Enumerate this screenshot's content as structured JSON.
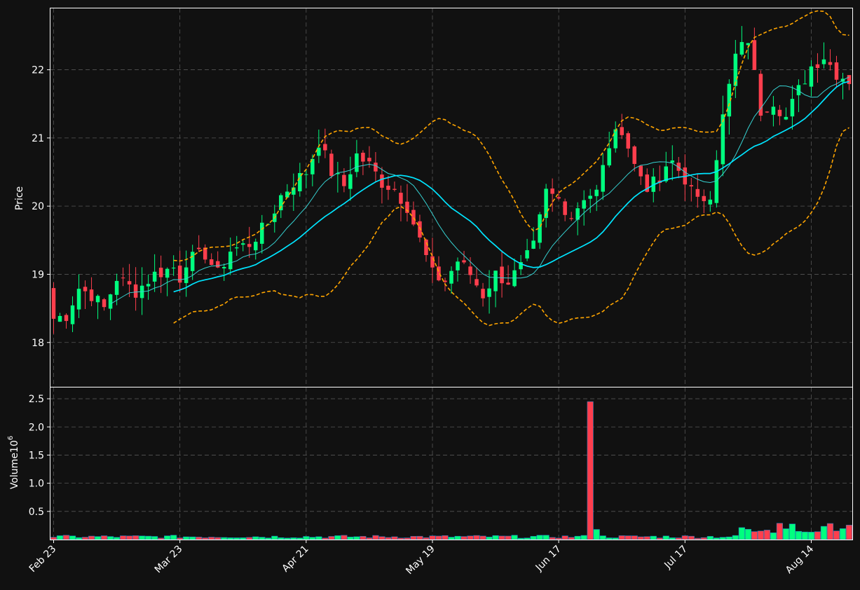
{
  "chart_data": {
    "type": "candlestick",
    "colors": {
      "background": "#111111",
      "up": "#00ff7f",
      "down": "#ff3e4d",
      "bollinger": "#ffa500",
      "ma_fast": "#36d1d1",
      "ma_slow": "#00e5ff",
      "grid": "#555555",
      "axis": "#ffffff"
    },
    "price_panel": {
      "ylabel": "Price",
      "ylim": [
        17.35,
        22.9
      ],
      "yticks": [
        18,
        19,
        20,
        21,
        22
      ]
    },
    "volume_panel": {
      "ylabel": "Volume",
      "ylabel_exp": "10",
      "ylabel_sup": "6",
      "ylim": [
        0,
        2.7
      ],
      "yticks": [
        "0.5",
        "1.0",
        "1.5",
        "2.0",
        "2.5"
      ],
      "ytick_values": [
        0.5,
        1.0,
        1.5,
        2.0,
        2.5
      ]
    },
    "xlim": [
      -0.5,
      126.5
    ],
    "xticks": [
      {
        "index": 0,
        "label": "Feb 23"
      },
      {
        "index": 20,
        "label": "Mar 23"
      },
      {
        "index": 40,
        "label": "Apr 21"
      },
      {
        "index": 60,
        "label": "May 19"
      },
      {
        "index": 80,
        "label": "Jun 17"
      },
      {
        "index": 100,
        "label": "Jul 17"
      },
      {
        "index": 120,
        "label": "Aug 14"
      }
    ],
    "close_keypoints": [
      [
        0,
        18.35
      ],
      [
        2,
        18.4
      ],
      [
        4,
        18.8
      ],
      [
        6,
        18.7
      ],
      [
        8,
        18.5
      ],
      [
        10,
        18.95
      ],
      [
        13,
        18.75
      ],
      [
        16,
        19.0
      ],
      [
        19,
        19.1
      ],
      [
        20,
        18.95
      ],
      [
        21,
        19.2
      ],
      [
        24,
        19.3
      ],
      [
        26,
        19.0
      ],
      [
        28,
        19.35
      ],
      [
        31,
        19.45
      ],
      [
        34,
        19.75
      ],
      [
        36,
        20.15
      ],
      [
        38,
        20.35
      ],
      [
        40,
        20.5
      ],
      [
        42,
        20.95
      ],
      [
        44,
        20.5
      ],
      [
        46,
        20.3
      ],
      [
        48,
        20.75
      ],
      [
        50,
        20.6
      ],
      [
        52,
        20.35
      ],
      [
        54,
        20.25
      ],
      [
        56,
        20.0
      ],
      [
        58,
        19.5
      ],
      [
        60,
        19.0
      ],
      [
        62,
        18.9
      ],
      [
        64,
        19.2
      ],
      [
        66,
        19.0
      ],
      [
        68,
        18.7
      ],
      [
        70,
        19.0
      ],
      [
        72,
        18.9
      ],
      [
        74,
        19.1
      ],
      [
        76,
        19.4
      ],
      [
        78,
        20.2
      ],
      [
        80,
        20.1
      ],
      [
        82,
        19.85
      ],
      [
        84,
        20.15
      ],
      [
        86,
        20.2
      ],
      [
        88,
        20.9
      ],
      [
        90,
        21.15
      ],
      [
        92,
        20.6
      ],
      [
        94,
        20.3
      ],
      [
        96,
        20.35
      ],
      [
        98,
        20.65
      ],
      [
        100,
        20.4
      ],
      [
        102,
        20.05
      ],
      [
        104,
        20.2
      ],
      [
        106,
        21.3
      ],
      [
        108,
        22.2
      ],
      [
        110,
        22.45
      ],
      [
        112,
        21.4
      ],
      [
        114,
        21.55
      ],
      [
        116,
        21.3
      ],
      [
        118,
        21.7
      ],
      [
        120,
        22.05
      ],
      [
        122,
        22.2
      ],
      [
        124,
        21.95
      ],
      [
        126,
        21.85
      ]
    ],
    "volume_spikes": [
      {
        "index": 85,
        "value": 2.45,
        "up": false
      },
      {
        "index": 86,
        "value": 0.18,
        "up": true
      }
    ],
    "volume_base": 0.06,
    "bollinger_start": 19,
    "ma_fast_window": 10,
    "ma_slow_window": 20,
    "bollinger_window": 20
  }
}
